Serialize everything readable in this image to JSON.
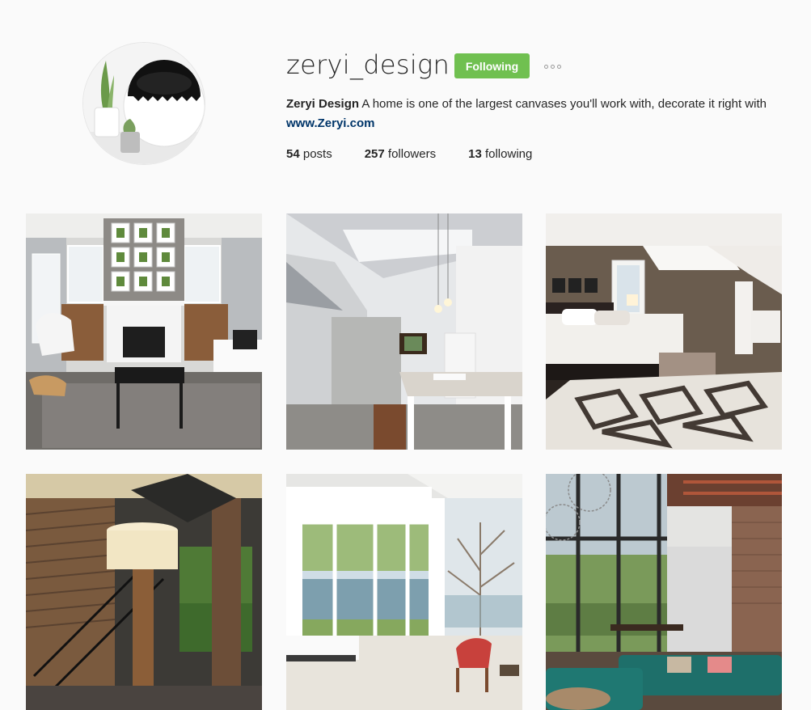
{
  "profile": {
    "username": "zeryi_design",
    "follow_label": "Following",
    "more_icon": "more-options-icon",
    "display_name": "Zeryi Design",
    "bio_text": " A home is one of the largest canvases you'll work with, decorate it right with ",
    "link_text": "www.Zeryi.com"
  },
  "stats": {
    "posts_count": "54",
    "posts_label": " posts",
    "followers_count": "257",
    "followers_label": " followers",
    "following_count": "13",
    "following_label": " following"
  },
  "colors": {
    "follow_green": "#70c050",
    "link_blue": "#003569",
    "background": "#fafafa"
  },
  "posts": [
    {
      "subject": "living room with fireplace and lounge chair"
    },
    {
      "subject": "loft kitchen with concrete staircase"
    },
    {
      "subject": "bedroom with patterned rug"
    },
    {
      "subject": "stairwell with tree-trunk floor lamp"
    },
    {
      "subject": "bright room with lake view and red chair"
    },
    {
      "subject": "loft living room with teal sofa and brick wall"
    }
  ]
}
